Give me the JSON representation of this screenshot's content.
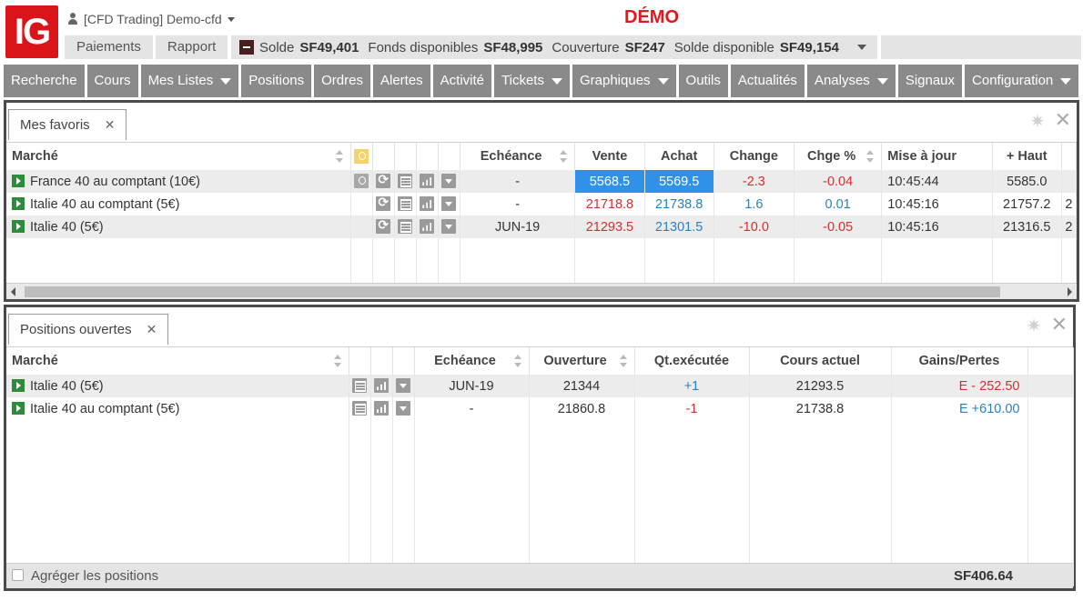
{
  "logo": "IG",
  "account": {
    "label": "[CFD Trading] Demo-cfd"
  },
  "demo_label": "DÉMO",
  "subnav": [
    {
      "label": "Paiements"
    },
    {
      "label": "Rapport"
    }
  ],
  "balance": {
    "solde_label": "Solde",
    "solde_value": "SF49,401",
    "fonds_label": "Fonds disponibles",
    "fonds_value": "SF48,995",
    "couverture_label": "Couverture",
    "couverture_value": "SF247",
    "dispo_label": "Solde disponible",
    "dispo_value": "SF49,154"
  },
  "mainnav": [
    {
      "label": "Recherche"
    },
    {
      "label": "Cours"
    },
    {
      "label": "Mes Listes"
    },
    {
      "label": "Positions"
    },
    {
      "label": "Ordres"
    },
    {
      "label": "Alertes"
    },
    {
      "label": "Activité"
    },
    {
      "label": "Tickets"
    },
    {
      "label": "Graphiques"
    },
    {
      "label": "Outils"
    },
    {
      "label": "Actualités"
    },
    {
      "label": "Analyses"
    },
    {
      "label": "Signaux"
    },
    {
      "label": "Configuration"
    }
  ],
  "favoris": {
    "tab_label": "Mes favoris",
    "headers": {
      "market": "Marché",
      "expiry": "Echéance",
      "sell": "Vente",
      "buy": "Achat",
      "change": "Change",
      "change_pct": "Chge %",
      "update": "Mise à jour",
      "high": "+ Haut"
    },
    "rows": [
      {
        "market": "France 40 au comptant (10€)",
        "expiry": "-",
        "sell": "5568.5",
        "buy": "5569.5",
        "change": "-2.3",
        "change_pct": "-0.04",
        "update": "10:45:44",
        "high": "5585.0",
        "extra": ""
      },
      {
        "market": "Italie 40 au comptant (5€)",
        "expiry": "-",
        "sell": "21718.8",
        "buy": "21738.8",
        "change": "1.6",
        "change_pct": "0.01",
        "update": "10:45:16",
        "high": "21757.2",
        "extra": "2"
      },
      {
        "market": "Italie 40 (5€)",
        "expiry": "JUN-19",
        "sell": "21293.5",
        "buy": "21301.5",
        "change": "-10.0",
        "change_pct": "-0.05",
        "update": "10:45:16",
        "high": "21316.5",
        "extra": "2"
      }
    ]
  },
  "positions": {
    "tab_label": "Positions ouvertes",
    "headers": {
      "market": "Marché",
      "expiry": "Echéance",
      "open": "Ouverture",
      "qty": "Qt.exécutée",
      "current": "Cours actuel",
      "pnl": "Gains/Pertes"
    },
    "rows": [
      {
        "market": "Italie 40 (5€)",
        "expiry": "JUN-19",
        "open": "21344",
        "qty": "+1",
        "current": "21293.5",
        "pnl": "E - 252.50"
      },
      {
        "market": "Italie 40 au comptant (5€)",
        "expiry": "-",
        "open": "21860.8",
        "qty": "-1",
        "current": "21738.8",
        "pnl": "E +610.00"
      }
    ],
    "aggregate_label": "Agréger les positions",
    "total": "SF406.64"
  },
  "colors": {
    "brand": "#d9151a",
    "nav_bg": "#8a8a8a",
    "negative": "#d32f2f",
    "positive": "#2a7fc0",
    "highlight": "#2f92e8"
  }
}
